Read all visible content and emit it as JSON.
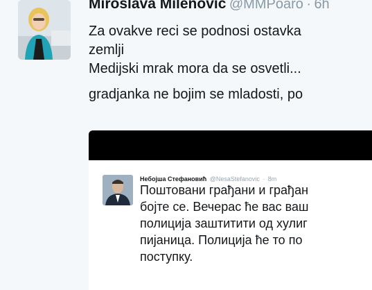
{
  "tweet": {
    "name": "Miroslava Milenovic",
    "handle": "@MMPoaro",
    "separator": "·",
    "time": "6h",
    "lines": [
      "Za ovakve reci se podnosi ostavka",
      "zemlji",
      "Medijski mrak mora da se osvetli...",
      "gradjanka ne bojim se mladosti, po"
    ]
  },
  "embedded_tweet": {
    "name": "Небојша Стефановић",
    "handle": "@NesaStefanovic",
    "separator": "·",
    "time": "8m",
    "lines": [
      "Поштовани грађани и грађан",
      "бојте се. Вечерас ће вас ваш",
      "полиција заштитити од хулиг",
      "пијаница. Полиција ће то по",
      "поступку."
    ]
  }
}
